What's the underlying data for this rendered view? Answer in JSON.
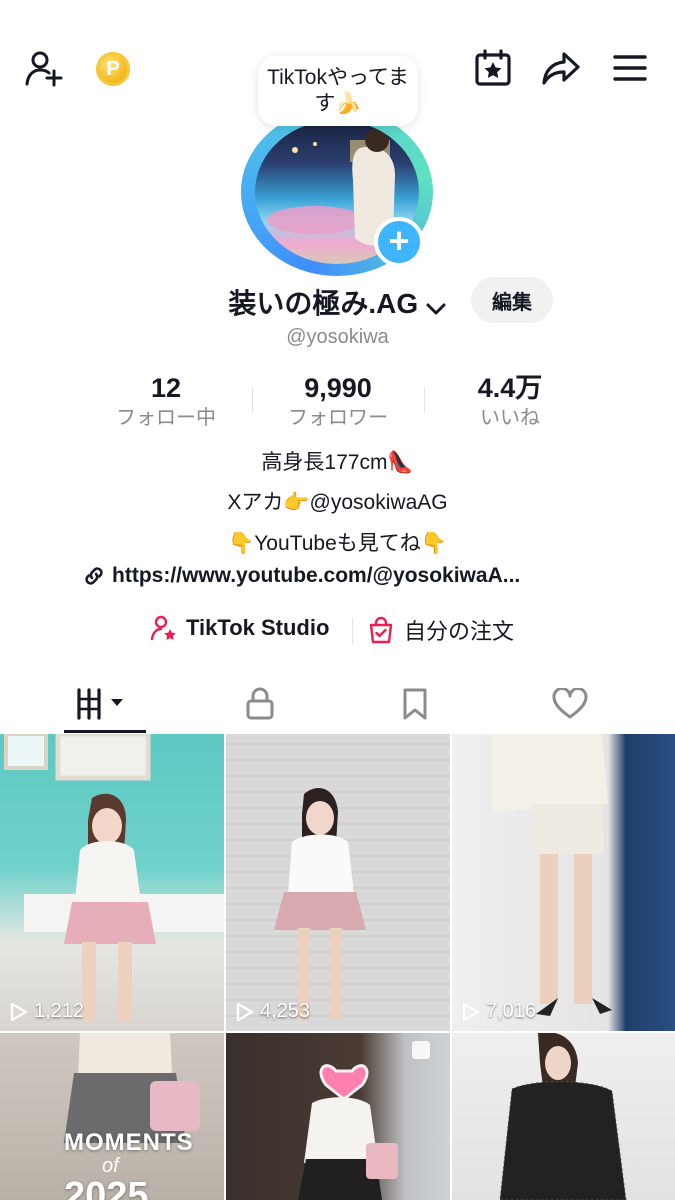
{
  "header": {
    "bubble_text": "TikTokやってます🍌",
    "coin_symbol": "P"
  },
  "profile": {
    "display_name": "装いの極み.AG",
    "edit_label": "編集",
    "handle": "@yosokiwa"
  },
  "stats": [
    {
      "value": "12",
      "label": "フォロー中"
    },
    {
      "value": "9,990",
      "label": "フォロワー"
    },
    {
      "value": "4.4万",
      "label": "いいね"
    }
  ],
  "bio": {
    "line1": "高身長177cm👠",
    "line2": "Xアカ👉@yosokiwaAG",
    "line3": "👇YouTubeも見てね👇",
    "link": "https://www.youtube.com/@yosokiwaA..."
  },
  "tools": {
    "studio_label": "TikTok Studio",
    "orders_label": "自分の注文"
  },
  "videos": [
    {
      "views": "1,212"
    },
    {
      "views": "4,253"
    },
    {
      "views": "7,016"
    },
    {
      "overlay_title": "MOMENTS",
      "overlay_sub": "of",
      "overlay_year": "2025"
    }
  ],
  "colors": {
    "accent_blue": "#3fb4ff",
    "studio_pink": "#ee1d52",
    "text_primary": "#161823",
    "text_secondary": "#8a8b91"
  }
}
